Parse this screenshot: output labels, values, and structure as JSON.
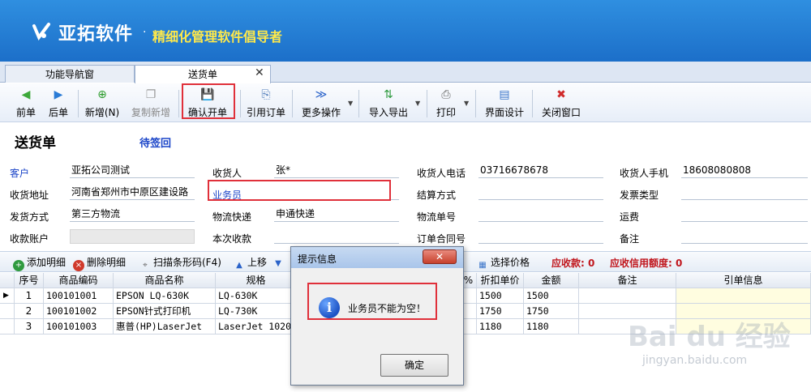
{
  "header": {
    "brand": "亚拓软件",
    "dot": "·",
    "slogan": "精细化管理软件倡导者"
  },
  "tabs": [
    {
      "label": "功能导航窗"
    },
    {
      "label": "送货单",
      "active": true
    }
  ],
  "tab_close": "✕",
  "toolbar": {
    "prev": "前单",
    "next": "后单",
    "add": "新增(N)",
    "copy_add": "复制新增",
    "confirm": "确认开单",
    "ref_order": "引用订单",
    "more": "更多操作",
    "import_export": "导入导出",
    "print": "打印",
    "ui_design": "界面设计",
    "close_window": "关闭窗口"
  },
  "doc": {
    "title": "送货单",
    "status": "待签回"
  },
  "form": {
    "customer_label": "客户",
    "customer_value": "亚拓公司测试",
    "receiver_label": "收货人",
    "receiver_value": "张*",
    "receiver_phone_label": "收货人电话",
    "receiver_phone_value": "03716678678",
    "receiver_mobile_label": "收货人手机",
    "receiver_mobile_value": "18608080808",
    "address_label": "收货地址",
    "address_value": "河南省郑州市中原区建设路",
    "salesman_label": "业务员",
    "salesman_value": "",
    "settlement_label": "结算方式",
    "settlement_value": "",
    "invoice_label": "发票类型",
    "invoice_value": "",
    "ship_method_label": "发货方式",
    "ship_method_value": "第三方物流",
    "logistics_label": "物流快递",
    "logistics_value": "申通快递",
    "logistics_no_label": "物流单号",
    "logistics_no_value": "",
    "freight_label": "运费",
    "freight_value": "",
    "account_label": "收款账户",
    "account_value": "",
    "receipt_label": "本次收款",
    "receipt_value": "",
    "contract_label": "订单合同号",
    "contract_value": "",
    "remark_label": "备注",
    "remark_value": ""
  },
  "detail_bar": {
    "add_detail": "添加明细",
    "delete_detail": "删除明细",
    "scan_barcode": "扫描条形码(F4)",
    "move_up": "上移",
    "select_price": "选择价格",
    "receivable": "应收款: 0",
    "credit": "应收信用额度: 0"
  },
  "grid": {
    "headers": [
      "序号",
      "商品编码",
      "商品名称",
      "规格",
      "%",
      "折扣单价",
      "金额",
      "备注",
      "引单信息"
    ],
    "rows": [
      {
        "seq": "1",
        "code": "100101001",
        "name": "EPSON LQ-630K",
        "spec": "LQ-630K",
        "price": "1500",
        "amount": "1500"
      },
      {
        "seq": "2",
        "code": "100101002",
        "name": "EPSON针式打印机",
        "spec": "LQ-730K",
        "price": "1750",
        "amount": "1750"
      },
      {
        "seq": "3",
        "code": "100101003",
        "name": "惠普(HP)LaserJet",
        "spec": "LaserJet 1020",
        "price": "1180",
        "amount": "1180"
      }
    ]
  },
  "dialog": {
    "title": "提示信息",
    "close": "✕",
    "message": "业务员不能为空！",
    "ok": "确定"
  },
  "watermark": {
    "main": "Bai du 经验",
    "sub": "jingyan.baidu.com"
  },
  "colors": {
    "banner": "#1c6fc9",
    "slogan": "#ffe94a",
    "highlight": "#e0303a",
    "link_blue": "#1a44c8",
    "amount_red": "#c0151c"
  }
}
